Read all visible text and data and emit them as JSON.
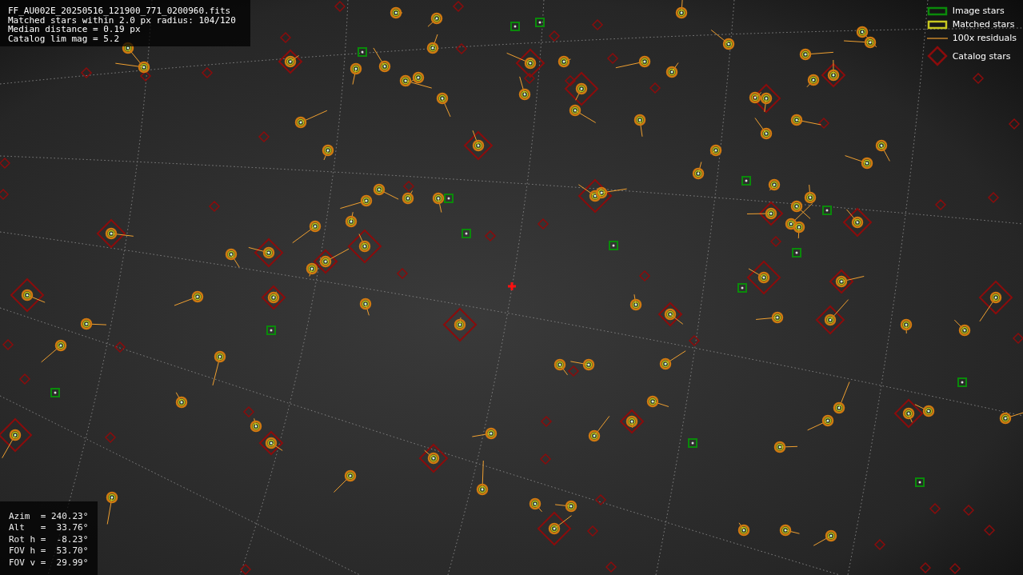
{
  "info_lines": [
    "FF_AU002E_20250516_121900_771_0200960.fits",
    "Matched stars within 2.0 px radius: 104/120",
    "Median distance = 0.19 px",
    "Catalog lim mag = 5.2"
  ],
  "legend": [
    {
      "kind": "image_star",
      "label": "Image stars"
    },
    {
      "kind": "matched_star",
      "label": "Matched stars"
    },
    {
      "kind": "residual",
      "label": "100x residuals"
    },
    {
      "kind": "catalog_star",
      "label": "Catalog stars"
    }
  ],
  "pointing_lines": [
    "Azim  = 240.23°",
    "Alt   =  33.76°",
    "Rot h =  -8.23°",
    "FOV h =  53.70°",
    "FOV v =  29.99°"
  ]
}
